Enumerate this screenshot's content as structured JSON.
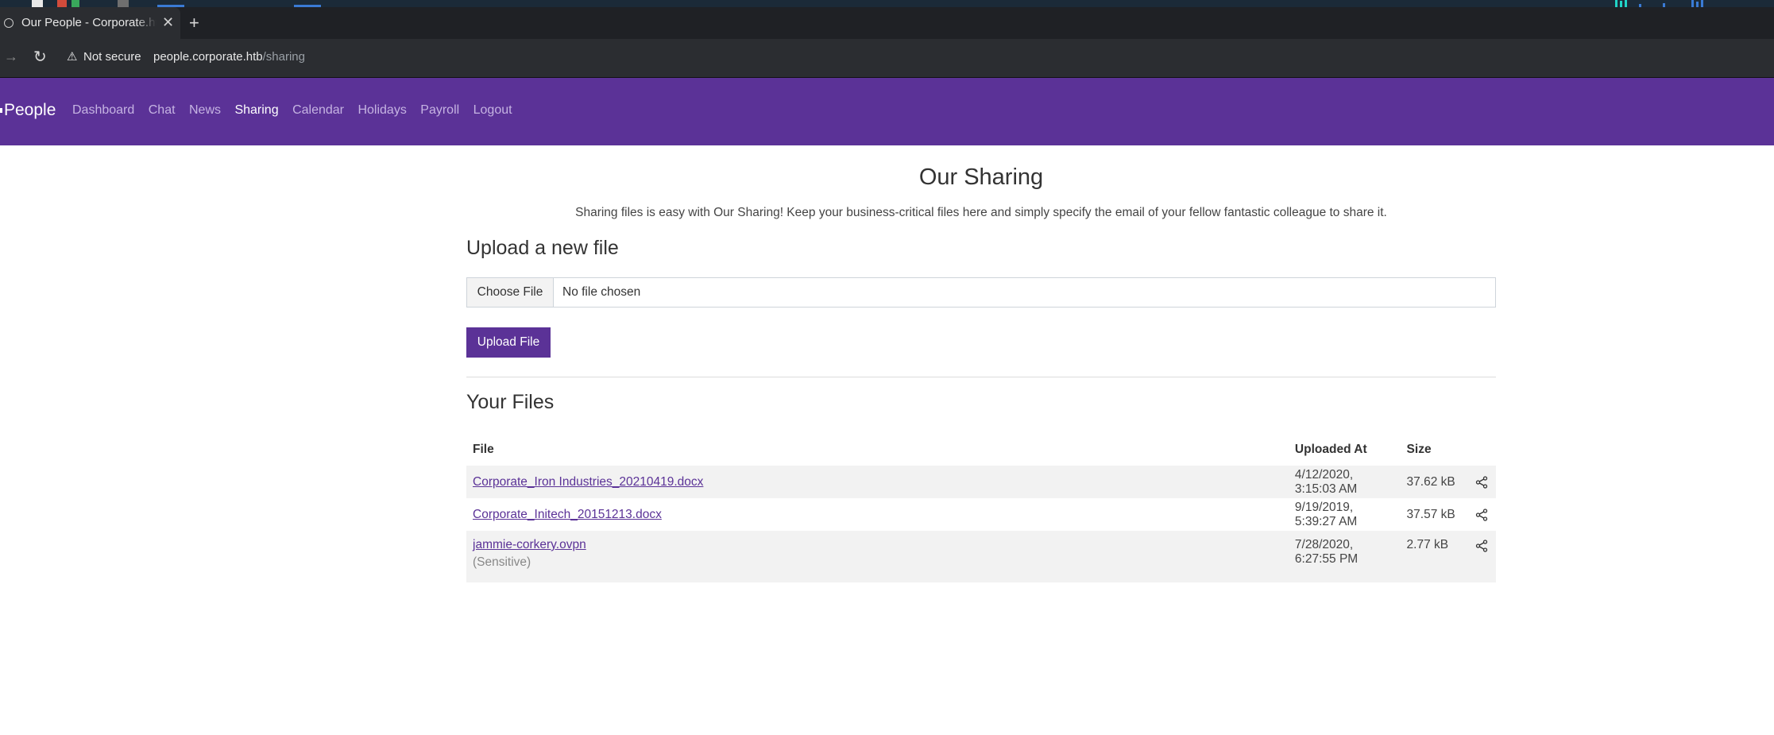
{
  "browser": {
    "tab_title": "Our People - Corporate.htb",
    "close_glyph": "✕",
    "new_tab_glyph": "+",
    "security_label": "Not secure",
    "url_host": "people.corporate.htb",
    "url_path": "/sharing"
  },
  "nav": {
    "brand": "People",
    "links": [
      "Dashboard",
      "Chat",
      "News",
      "Sharing",
      "Calendar",
      "Holidays",
      "Payroll",
      "Logout"
    ],
    "active": "Sharing"
  },
  "page": {
    "title": "Our Sharing",
    "lead": "Sharing files is easy with Our Sharing! Keep your business-critical files here and simply specify the email of your fellow fantastic colleague to share it.",
    "upload_heading": "Upload a new file",
    "choose_file_label": "Choose File",
    "no_file_label": "No file chosen",
    "upload_button": "Upload File",
    "files_heading": "Your Files"
  },
  "files_table": {
    "headers": [
      "File",
      "Uploaded At",
      "Size"
    ],
    "rows": [
      {
        "name": "Corporate_Iron Industries_20210419.docx",
        "uploaded_at": "4/12/2020, 3:15:03 AM",
        "size": "37.62 kB",
        "note": ""
      },
      {
        "name": "Corporate_Initech_20151213.docx",
        "uploaded_at": "9/19/2019, 5:39:27 AM",
        "size": "37.57 kB",
        "note": ""
      },
      {
        "name": "jammie-corkery.ovpn",
        "uploaded_at": "7/28/2020, 6:27:55 PM",
        "size": "2.77 kB",
        "note": "(Sensitive)"
      }
    ]
  },
  "colors": {
    "brand": "#5b3297",
    "nav_inactive": "#c5b3e2",
    "row_stripe": "#f2f2f2"
  },
  "icons": {
    "share": "share-icon",
    "warning": "warning-icon",
    "reload": "reload-icon",
    "forward": "forward-arrow-icon",
    "globe": "globe-icon"
  }
}
